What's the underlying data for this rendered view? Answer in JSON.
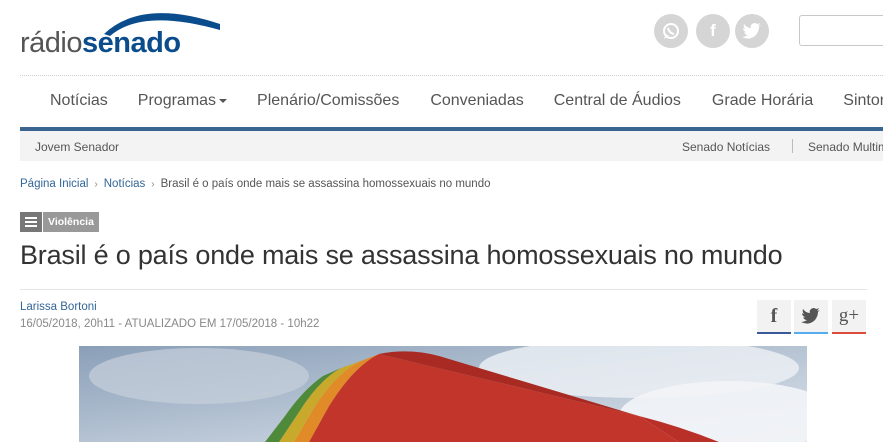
{
  "logo": {
    "part1": "rádio",
    "part2": "senado"
  },
  "social": {
    "whatsapp_icon": "whatsapp-icon",
    "facebook_icon": "f",
    "twitter_icon": "twitter-icon"
  },
  "search": {
    "placeholder": ""
  },
  "nav": {
    "items": [
      "Notícias",
      "Programas",
      "Plenário/Comissões",
      "Conveniadas",
      "Central de Áudios",
      "Grade Horária",
      "Sintonize"
    ]
  },
  "subnav": {
    "left": "Jovem Senador",
    "right1": "Senado Notícias",
    "right2": "Senado Multimídia"
  },
  "breadcrumb": {
    "home": "Página Inicial",
    "section": "Notícias",
    "current": "Brasil é o país onde mais se assassina homossexuais no mundo"
  },
  "category": {
    "label": "Violência"
  },
  "article": {
    "title": "Brasil é o país onde mais se assassina homossexuais no mundo",
    "author": "Larissa Bortoni",
    "date": "16/05/2018, 20h11 - ATUALIZADO EM 17/05/2018 - 10h22"
  },
  "share": {
    "facebook": "f",
    "google_plus": "g+"
  },
  "colors": {
    "brand_blue": "#0b4d8c",
    "nav_bar": "#3a6591",
    "link": "#336699"
  }
}
